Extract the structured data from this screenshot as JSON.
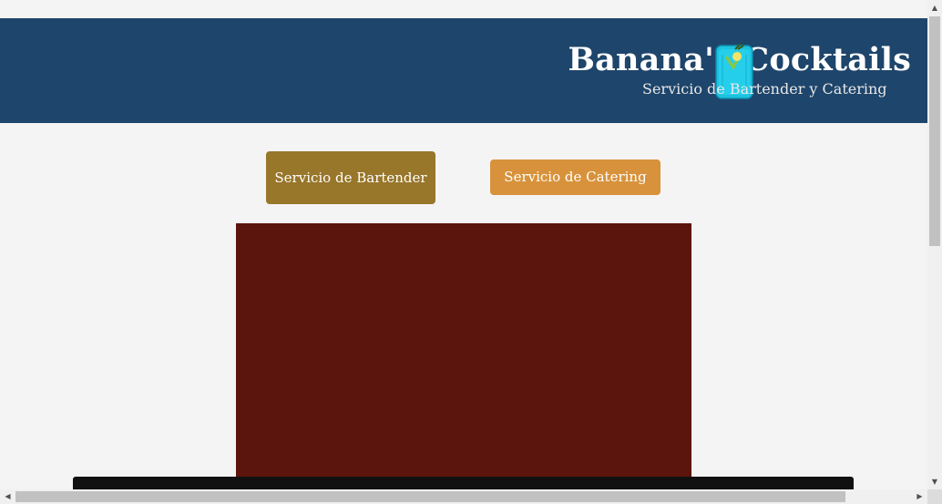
{
  "header": {
    "title": "Banana's Cocktails",
    "subtitle": "Servicio de Bartender y Catering",
    "logo_icon": "cocktail-glass-icon"
  },
  "services": {
    "bartender_label": "Servicio de Bartender",
    "catering_label": "Servicio de Catering"
  },
  "colors": {
    "header_bg": "#1e456b",
    "bartender_button": "#98762a",
    "catering_button": "#d8923b",
    "panel": "#5b150c",
    "page_bg": "#f4f4f4"
  },
  "scrollbars": {
    "up_icon": "arrow-up-icon",
    "down_icon": "arrow-down-icon",
    "left_icon": "arrow-left-icon",
    "right_icon": "arrow-right-icon"
  }
}
